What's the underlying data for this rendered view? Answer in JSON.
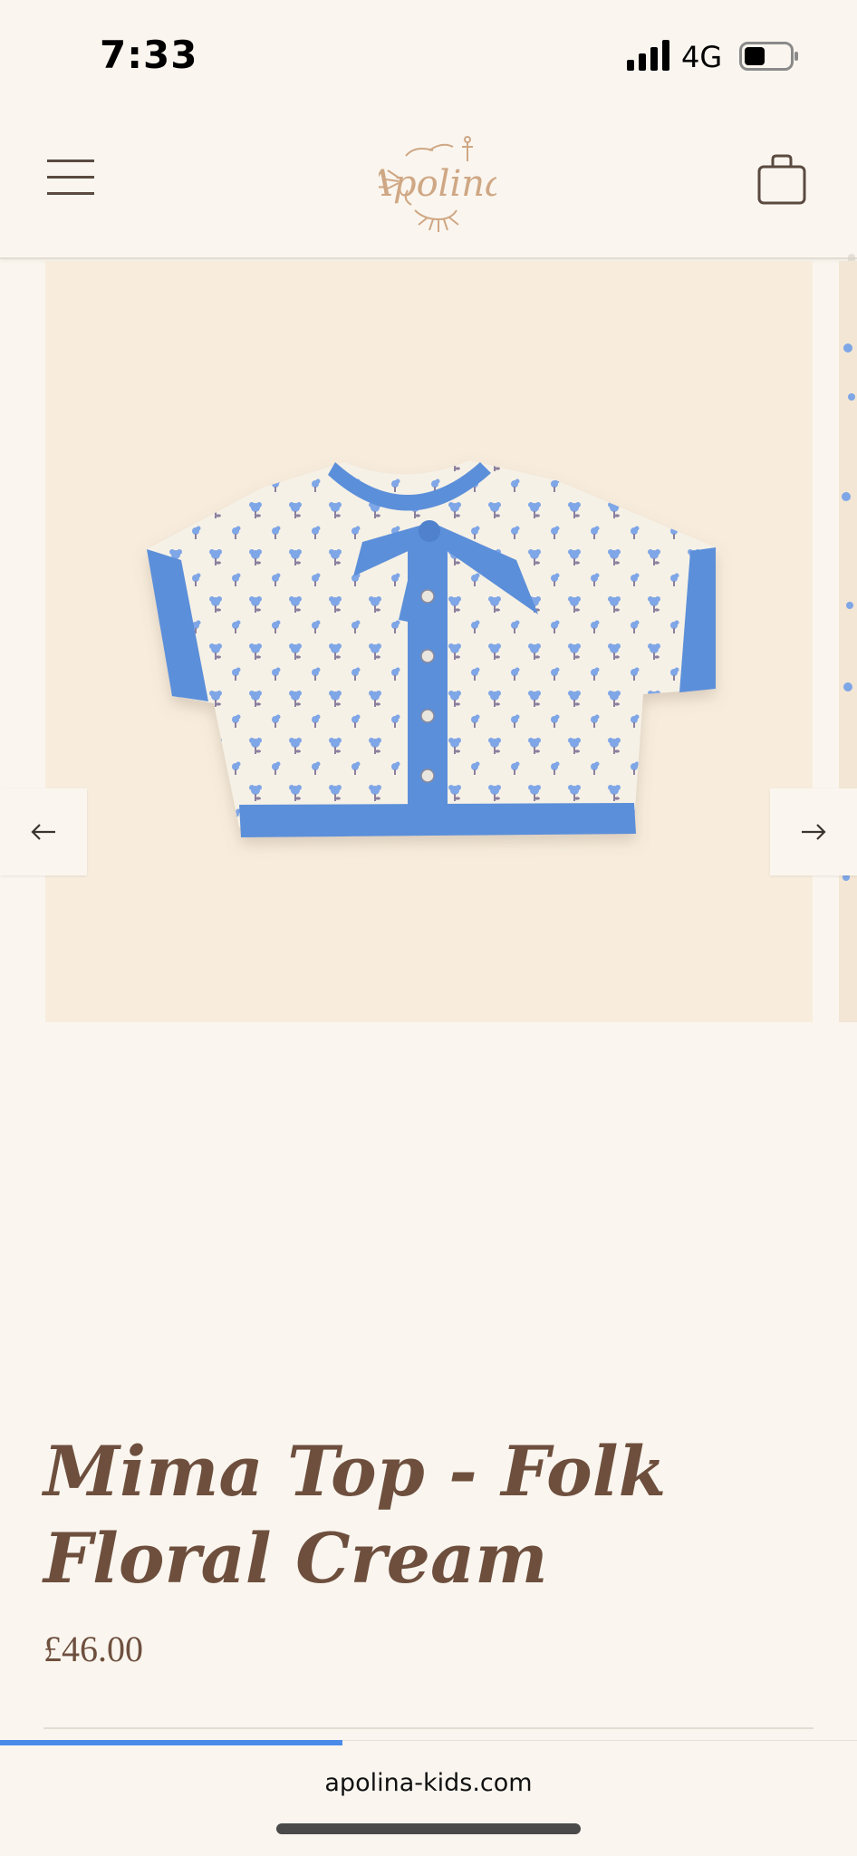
{
  "status_bar": {
    "time": "7:33",
    "network": "4G",
    "signal_icon": "signal-bars-icon",
    "battery_icon": "battery-icon"
  },
  "header": {
    "menu_icon": "hamburger-menu-icon",
    "logo_alt": "Apolina",
    "cart_icon": "shopping-bag-icon"
  },
  "gallery": {
    "prev_icon": "arrow-left-icon",
    "next_icon": "arrow-right-icon",
    "background_color": "#F8EDDD",
    "garment_trim_color": "#5B8FD9"
  },
  "product": {
    "title": "Mima Top - Folk Floral Cream",
    "price": "£46.00"
  },
  "browser": {
    "url": "apolina-kids.com",
    "load_progress": 0.4
  },
  "colors": {
    "background": "#FAF6EF",
    "text_brown": "#6E4F3E",
    "accent_blue": "#4A8BEA"
  }
}
